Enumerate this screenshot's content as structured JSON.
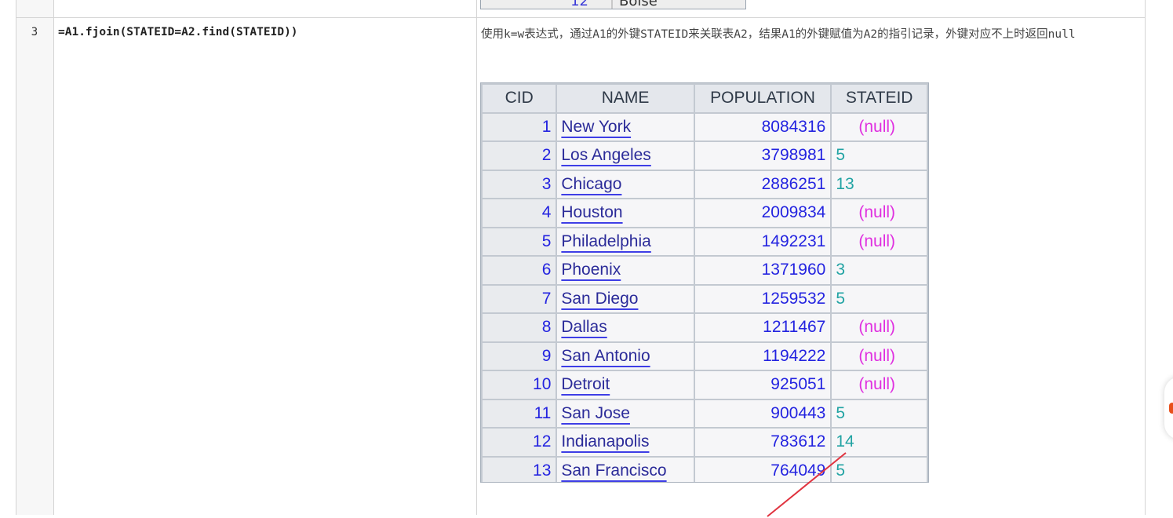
{
  "row": {
    "number": "3",
    "expression": "=A1.fjoin(STATEID=A2.find(STATEID))",
    "description": "使用k=w表达式，通过A1的外键STATEID来关联表A2，结果A1的外键赋值为A2的指引记录，外键对应不上时返回null"
  },
  "prev_fragment": {
    "num": "12",
    "name": "Boise"
  },
  "result_grid": {
    "headers": [
      "CID",
      "NAME",
      "POPULATION",
      "STATEID"
    ],
    "rows": [
      {
        "cid": "1",
        "name": "New York",
        "population": "8084316",
        "stateid": "(null)"
      },
      {
        "cid": "2",
        "name": "Los Angeles",
        "population": "3798981",
        "stateid": "5"
      },
      {
        "cid": "3",
        "name": "Chicago",
        "population": "2886251",
        "stateid": "13"
      },
      {
        "cid": "4",
        "name": "Houston",
        "population": "2009834",
        "stateid": "(null)"
      },
      {
        "cid": "5",
        "name": "Philadelphia",
        "population": "1492231",
        "stateid": "(null)"
      },
      {
        "cid": "6",
        "name": "Phoenix",
        "population": "1371960",
        "stateid": "3"
      },
      {
        "cid": "7",
        "name": "San Diego",
        "population": "1259532",
        "stateid": "5"
      },
      {
        "cid": "8",
        "name": "Dallas",
        "population": "1211467",
        "stateid": "(null)"
      },
      {
        "cid": "9",
        "name": "San Antonio",
        "population": "1194222",
        "stateid": "(null)"
      },
      {
        "cid": "10",
        "name": "Detroit",
        "population": "925051",
        "stateid": "(null)"
      },
      {
        "cid": "11",
        "name": "San Jose",
        "population": "900443",
        "stateid": "5"
      },
      {
        "cid": "12",
        "name": "Indianapolis",
        "population": "783612",
        "stateid": "14"
      },
      {
        "cid": "13",
        "name": "San Francisco",
        "population": "764049",
        "stateid": "5"
      }
    ]
  },
  "colors": {
    "link_blue": "#2323e0",
    "null_magenta": "#e030e0",
    "stateid_teal": "#21a3a3",
    "arrow_red": "#e0333f",
    "side_button_accent": "#e8501c"
  }
}
